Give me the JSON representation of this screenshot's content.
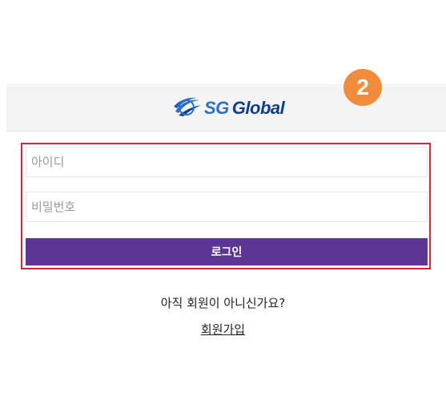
{
  "header": {
    "logo_sg": "SG",
    "logo_global": "Global",
    "logo_icon": "globe-swoosh-icon",
    "brand_colors": {
      "sg": "#2a70c9",
      "global": "#0f3d8c"
    }
  },
  "annotation": {
    "step_number": "2",
    "badge_color": "#f08c3c",
    "highlight_color": "#d4283a"
  },
  "login_form": {
    "id_placeholder": "아이디",
    "password_placeholder": "비밀번호",
    "submit_label": "로그인",
    "submit_color": "#5d3592"
  },
  "signup": {
    "question": "아직 회원이 아니신가요?",
    "link_label": "회원가입"
  }
}
